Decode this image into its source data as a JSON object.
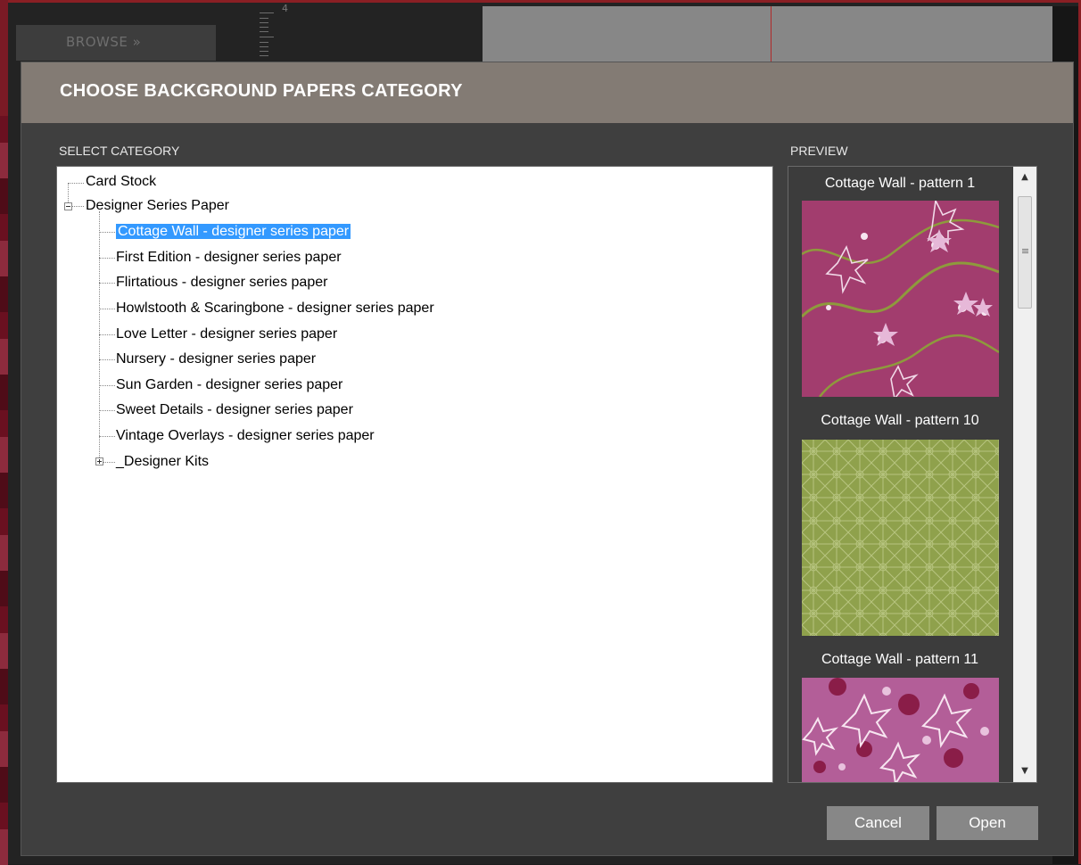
{
  "background": {
    "browse_label": "BROWSE »",
    "ruler_number": "4"
  },
  "dialog": {
    "title": "CHOOSE BACKGROUND PAPERS CATEGORY",
    "select_category_label": "SELECT CATEGORY",
    "preview_label": "PREVIEW",
    "tree": {
      "card_stock": "Card Stock",
      "designer_series_paper": "Designer Series Paper",
      "children": [
        "Cottage Wall - designer series paper",
        "First Edition - designer series paper",
        "Flirtatious - designer series paper",
        "Howlstooth & Scaringbone - designer series paper",
        "Love Letter - designer series paper",
        "Nursery - designer series paper",
        "Sun Garden - designer series paper",
        "Sweet Details - designer series paper",
        "Vintage Overlays - designer series paper"
      ],
      "designer_kits": "_Designer Kits",
      "selected": "Cottage Wall - designer series paper"
    },
    "preview": {
      "items": [
        {
          "caption": "Cottage Wall - pattern 1",
          "color": "#a23d6e"
        },
        {
          "caption": "Cottage Wall - pattern 10",
          "color": "#8fa14c"
        },
        {
          "caption": "Cottage Wall - pattern 11",
          "color": "#b35e98"
        }
      ]
    },
    "buttons": {
      "cancel": "Cancel",
      "open": "Open"
    }
  },
  "colors": {
    "header": "#837b74",
    "dialog_bg": "#3f3f3f",
    "selection": "#3399ff",
    "button": "#878787"
  }
}
